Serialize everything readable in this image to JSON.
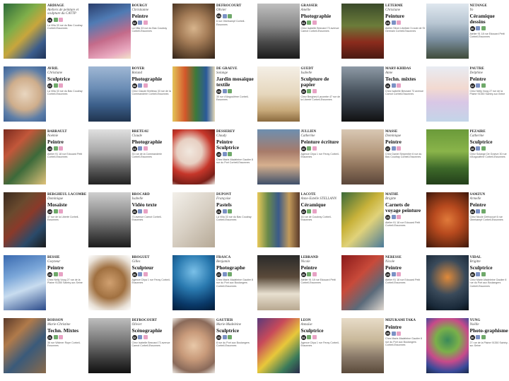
{
  "cells": [
    {
      "name": "ARDIAGE",
      "first": "Ateliers de peinture et sculpture du CATTP",
      "disc": "",
      "num": "01",
      "addr": "La Villa 33 rue du Bas Coudray Corbeil-Essonnes",
      "img": "linear-gradient(135deg,#2d6b3a 0%,#7fae4a 35%,#c8a63c 55%,#3b5c8c 80%,#1e3356 100%)"
    },
    {
      "name": "BOURGY",
      "first": "Christianne",
      "disc": "Peintre",
      "num": "02",
      "addr": "La Villa 33 rue du Bas Coudray Corbeil-Essonnes",
      "img": "linear-gradient(160deg,#2a3d6b 0%,#4f7bb4 30%,#c46b8a 60%,#e9a9c0 85%,#f1e3c9 100%)"
    },
    {
      "name": "DEFROCOURT",
      "first": "Olivier",
      "disc": "",
      "num": "03",
      "addr": "6 rue Oberkampf Corbeil-Essonnes",
      "img": "radial-gradient(circle at 50% 45%,#d7b48c 0%,#a47c57 40%,#5a412b 80%,#2e2118 100%)"
    },
    {
      "name": "GRASSER",
      "first": "Amélie",
      "disc": "Photographie",
      "num": "04",
      "addr": "Chez Isabelle Besnard 73 avenue Carnot Corbeil-Essonnes",
      "img": "linear-gradient(180deg,#bfbfbf 0%,#8a8a8a 40%,#4a4a4a 70%,#1a1a1a 100%)"
    },
    {
      "name": "LETERME",
      "first": "Christiane",
      "disc": "Peinture",
      "num": "05",
      "addr": "Atelier Silver Libellule 3 route de St Germain Corbeil-Essonnes",
      "img": "linear-gradient(180deg,#3a4a2a 0%,#6b7c3a 40%,#8b2b1d 70%,#4a1a12 100%)"
    },
    {
      "name": "NETANGE",
      "first": "Yo",
      "disc": "Céramique dessins",
      "num": "06",
      "addr": "Atelier 91 18 rue Edouard Petit Corbeil-Essonnes",
      "img": "linear-gradient(180deg,#dfe7ef 0%,#b9c7d3 35%,#7b8fa0 65%,#3f4b3a 100%)"
    },
    {
      "name": "AVRIL",
      "first": "Christiane",
      "disc": "Sculptrice",
      "num": "07",
      "addr": "La Villa 33 rue du Bas Coudray Corbeil-Essonnes",
      "img": "radial-gradient(circle at 50% 50%,#e9d6c0 0%,#cfae8c 45%,#5d7ea8 75%,#3e6296 100%)"
    },
    {
      "name": "BOYER",
      "first": "Roland",
      "disc": "Photographie",
      "num": "08",
      "addr": "Chez Claude Bretteau 33 rue de la Commanderie Corbeil-Essonnes",
      "img": "linear-gradient(180deg,#9fb7d4 0%,#6b8db5 40%,#3c5f8a 70%,#20344f 100%)"
    },
    {
      "name": "DE GRAEVE",
      "first": "Solange",
      "disc": "Jardin mosaïque textile",
      "num": "09",
      "addr": "30 rue d'Angoulême Corbeil-Essonnes",
      "img": "linear-gradient(90deg,#e3c45a 0%,#d4572a 30%,#3c7a3a 55%,#2b5a9a 80%,#e6d9b8 100%)"
    },
    {
      "name": "GUEDT",
      "first": "Isabelle",
      "disc": "Sculpture de papier",
      "num": "10",
      "addr": "Chez Bergheul Lacombe 47 rue de la Liberté Corbeil-Essonnes",
      "img": "linear-gradient(180deg,#f4efe6 0%,#e6d7bd 50%,#c7a979 80%,#8a6a3e 100%)"
    },
    {
      "name": "MARY-KHIDAS",
      "first": "Anne",
      "disc": "Techn. mixtes",
      "num": "11",
      "addr": "Chez Isabelle Besnard 73 avenue Carnot Corbeil-Essonnes",
      "img": "linear-gradient(180deg,#8e9aa6 0%,#4a5560 45%,#2a3038 75%,#111 100%)"
    },
    {
      "name": "PAUTRE",
      "first": "Delphine",
      "disc": "Peintre",
      "num": "12",
      "addr": "Chez Nelly Voog 27 rue de la Plaine 91350 Saintry-sur-Seine",
      "img": "linear-gradient(180deg,#e8ecf3 0%,#f2d9d0 40%,#d9c7e6 65%,#c3d5e8 100%)"
    },
    {
      "name": "BARRAULT",
      "first": "Noémie",
      "disc": "Peintre",
      "num": "13",
      "addr": "Atelier 91 18 rue Edouard Petit Corbeil-Essonnes",
      "img": "linear-gradient(135deg,#7a2a1e 0%,#c2573a 30%,#3c6a3a 60%,#e0c27a 100%)"
    },
    {
      "name": "BRETEAU",
      "first": "Claude",
      "disc": "Photographie",
      "num": "14",
      "addr": "33 rue de la Commanderie Corbeil-Essonnes",
      "img": "linear-gradient(180deg,#e0e0e0 0%,#a8a8a8 40%,#5e5e5e 70%,#222 100%)"
    },
    {
      "name": "DESSEREY",
      "first": "Claudy",
      "disc": "Peintre Sculptrice",
      "num": "15",
      "addr": "Chez Marie-Madeleine Gautier 8 rue du Port Corbeil-Essonnes",
      "img": "radial-gradient(circle at 40% 40%,#f1e8df 0%,#e7cfc2 30%,#c6362a 55%,#7a1f18 80%,#f3ede6 100%)"
    },
    {
      "name": "JULLIEN",
      "first": "Catherine",
      "disc": "Peinture écriture",
      "num": "16",
      "addr": "Agence Citya 1 rue Feray Corbeil-Essonnes",
      "img": "linear-gradient(180deg,#6d8fb0 0%,#a77b6a 40%,#d6b08e 65%,#3e4f6a 100%)"
    },
    {
      "name": "MASSE",
      "first": "Dominique",
      "disc": "Peintre",
      "num": "17",
      "addr": "Chez Daniel Serpentier 6 rue du Bas Coudray Corbeil-Essonnes",
      "img": "linear-gradient(180deg,#d9c8b4 0%,#b79c80 40%,#8a6f58 70%,#5a463a 100%)"
    },
    {
      "name": "PEZAIRE",
      "first": "Catherine",
      "disc": "Sculptrice",
      "num": "18",
      "addr": "Chez Solange De Graeve 30 rue d'Angoulême Corbeil-Essonnes",
      "img": "linear-gradient(180deg,#6a9a3a 0%,#8ab44a 40%,#3e6a2a 70%,#233f1a 100%)"
    },
    {
      "name": "BERGHEUL LACOMBE",
      "first": "Dominique",
      "disc": "Mosaïste",
      "num": "19",
      "addr": "47 rue de la Liberté Corbeil-Essonnes",
      "img": "linear-gradient(135deg,#3a2a1e 0%,#6a4a2e 30%,#8a3a2a 50%,#2a4a6a 75%,#1a1a1a 100%)"
    },
    {
      "name": "BROCARD",
      "first": "Isabelle",
      "disc": "Vidéo texte",
      "num": "20",
      "addr": "73 avenue Carnot Corbeil-Essonnes",
      "img": "linear-gradient(180deg,#cfcfcf 0%,#8f8f8f 40%,#4a4a4a 75%,#1c1c1c 100%)"
    },
    {
      "name": "DUPONT",
      "first": "Françoise",
      "disc": "Pastels",
      "num": "21",
      "addr": "La Villa 33 rue du Bas Coudray Corbeil-Essonnes",
      "img": "linear-gradient(135deg,#f3f0ea 0%,#d8d0c4 50%,#b6a996 100%)"
    },
    {
      "name": "LACOTE",
      "first": "Anne-Estelle STELLANN",
      "disc": "Céramique",
      "num": "22",
      "addr": "16 rue de Coudray Corbeil-Essonnes",
      "img": "linear-gradient(90deg,#e8c85a 0%,#6a8a4a 25%,#3a5a8a 50%,#c29a5a 75%,#5a3a2a 100%)"
    },
    {
      "name": "MATHÉ",
      "first": "Brigitte",
      "disc": "Carnets de voyage peinture",
      "num": "23",
      "addr": "Atelier 91 18 rue Edouard Petit Corbeil-Essonnes",
      "img": "linear-gradient(135deg,#3a6a3a 0%,#c8b23a 40%,#e0d27a 60%,#4a7a9a 100%)"
    },
    {
      "name": "SAMZUN",
      "first": "Armelle",
      "disc": "Peintre",
      "num": "24",
      "addr": "Chez Nicole Defrocourt 6 rue Oberkampf Corbeil-Essonnes",
      "img": "radial-gradient(circle at 50% 50%,#e07a3a 0%,#b84a1e 40%,#6a2a12 80%,#3a160a 100%)"
    },
    {
      "name": "BESSIE",
      "first": "Gwyneur",
      "disc": "Peintre",
      "num": "25",
      "addr": "Chez Nelly Voog 27 rue de la Plaine 91350 Saintry-sur-Seine",
      "img": "linear-gradient(160deg,#3a6ab0 0%,#7aa6d8 35%,#c8dcef 60%,#2a4a8a 100%)"
    },
    {
      "name": "BROGUET",
      "first": "Gilles",
      "disc": "Sculpteur",
      "num": "26",
      "addr": "Agence Citya 1 rue Feray Corbeil-Essonnes",
      "img": "radial-gradient(circle at 50% 50%,#d0a070 0%,#a07040 45%,#e8e0d6 80%,#fff 100%)"
    },
    {
      "name": "FRASCA",
      "first": "Benjamin",
      "disc": "Photographe",
      "num": "27",
      "addr": "Chez Marie-Madeleine Gautier 8 rue du Port aux Boulangers Corbeil-Essonnes",
      "img": "radial-gradient(circle at 50% 30%,#7ac0e8 0%,#2a7ab0 40%,#0a3a6a 75%,#021a35 100%)"
    },
    {
      "name": "LEBRAND",
      "first": "Nicole",
      "disc": "Peintre",
      "num": "28",
      "addr": "Atelier 91 18 rue Edouard Petit Corbeil-Essonnes",
      "img": "linear-gradient(180deg,#2a2a2a 0%,#5a4a3a 40%,#e8e0d0 70%,#b8a890 100%)"
    },
    {
      "name": "NERESSE",
      "first": "Nicole",
      "disc": "Peintre",
      "num": "29",
      "addr": "Atelier 91 18 rue Edouard Petit Corbeil-Essonnes",
      "img": "linear-gradient(135deg,#8a1a1a 0%,#c84a3a 40%,#5a6a7a 70%,#e0d8d0 100%)"
    },
    {
      "name": "VIDAL",
      "first": "Brigitte",
      "disc": "Sculptrice",
      "num": "30",
      "addr": "Chez Marie-Madeleine Gautier 8 rue du Port aux Boulangers Corbeil-Essonnes",
      "img": "radial-gradient(circle at 50% 40%,#e08a3a 0%,#3a4a5a 45%,#1a2a3a 80%,#0a1016 100%)"
    },
    {
      "name": "BOISSON",
      "first": "Marie-Christine",
      "disc": "Techn. Mixtes",
      "num": "31",
      "addr": "36 rue Widmer Rope Corbeil-Essonnes",
      "img": "linear-gradient(135deg,#5a3a2a 0%,#b07a4a 30%,#3a5a7a 60%,#8a6a4a 100%)"
    },
    {
      "name": "DEFROCOURT",
      "first": "Olivier",
      "disc": "Scénographie",
      "num": "32",
      "addr": "Chez Isabelle Besnard 73 avenue Carnot Corbeil-Essonnes",
      "img": "linear-gradient(180deg,#bdbdbd 0%,#7a7a7a 40%,#3a3a3a 75%,#111 100%)"
    },
    {
      "name": "GAUTIER",
      "first": "Marie-Madeleine",
      "disc": "Sculptrice",
      "num": "33",
      "addr": "8 rue du Port aux Boulangers Corbeil-Essonnes",
      "img": "radial-gradient(circle at 50% 50%,#e8c8a8 0%,#c89a7a 40%,#8a6a5a 75%,#f0ece6 100%)"
    },
    {
      "name": "LEON",
      "first": "Annaïse",
      "disc": "Sculptrice",
      "num": "34",
      "addr": "Agence Citya 1 rue Feray Corbeil-Essonnes",
      "img": "linear-gradient(135deg,#5a3a7a 0%,#c84a5a 30%,#e8c83a 55%,#3a7a5a 80%,#2a2a4a 100%)"
    },
    {
      "name": "MIZUKAMI TAKA",
      "first": "",
      "disc": "Peintre",
      "num": "35",
      "addr": "Chez Marie-Madeleine Gautier 8 rue du Port aux Boulangers Corbeil-Essonnes",
      "img": "linear-gradient(180deg,#e8dcc8 0%,#c8b89a 40%,#8a7a6a 70%,#5a4a3a 100%)"
    },
    {
      "name": "YUNG",
      "first": "Noëlle",
      "disc": "Photo-graphisme",
      "num": "36",
      "addr": "27 rue de la Plaine 91350 Saintry-sur-Seine",
      "img": "radial-gradient(circle at 50% 40%,#3a8a5a 0%,#7ab04a 30%,#c84a8a 55%,#3a4a9a 80%,#1a2a4a 100%)"
    }
  ],
  "colors": {
    "discipline": "#1a1a1a",
    "badge": "#222222",
    "icon_a": "#7b91c4",
    "icon_b": "#e7a2c4",
    "icon_c": "#6fa96a"
  }
}
